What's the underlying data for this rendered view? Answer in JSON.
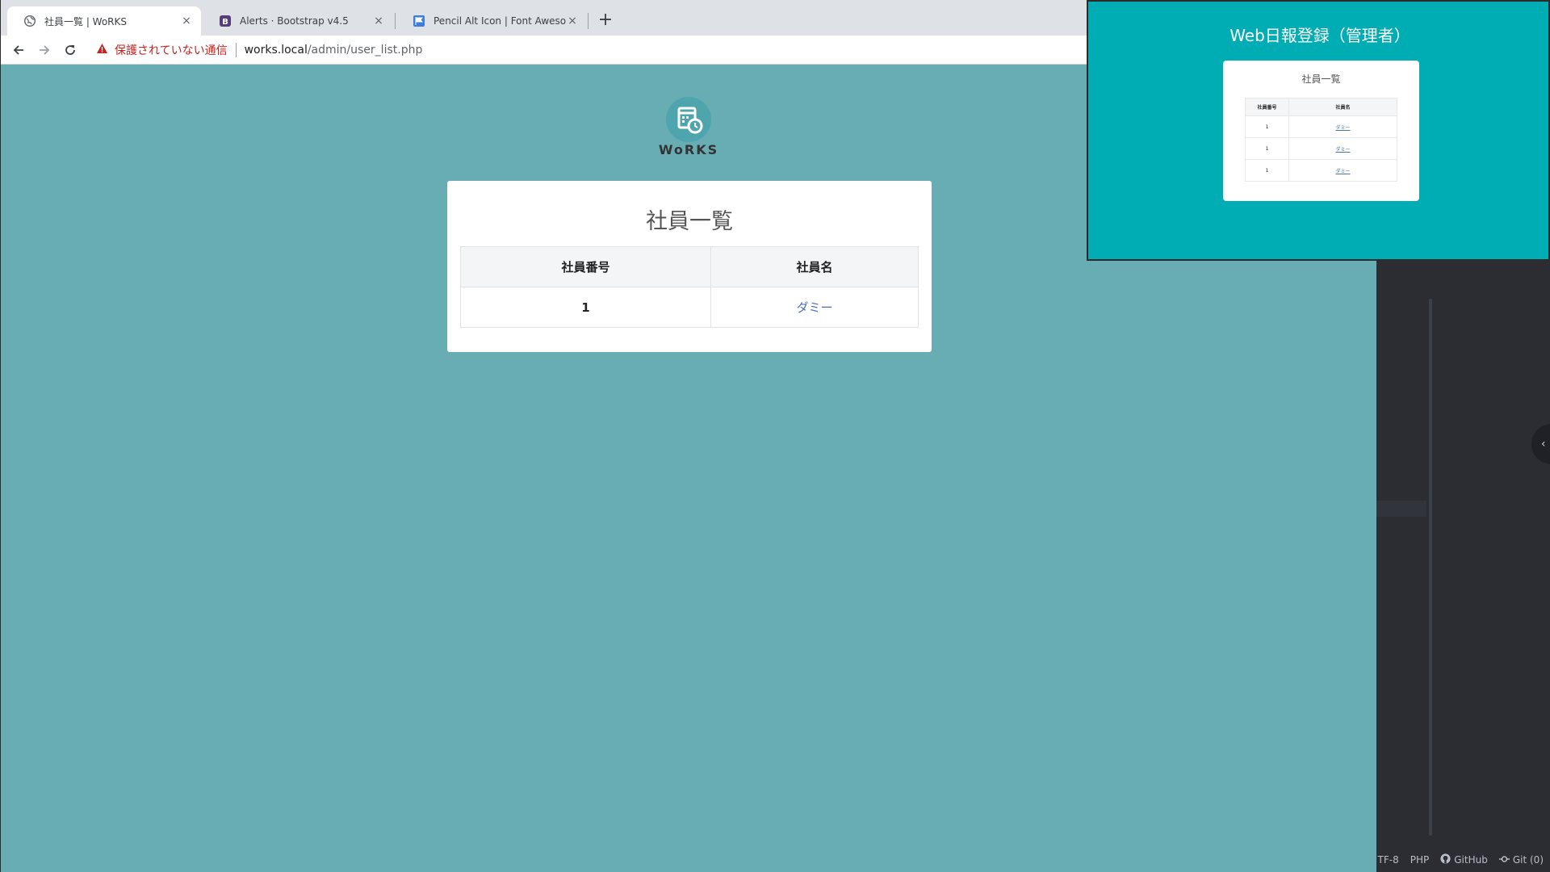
{
  "browser": {
    "tabs": [
      {
        "title": "社員一覧 | WoRKS",
        "favicon": "globe-icon",
        "active": true
      },
      {
        "title": "Alerts · Bootstrap v4.5",
        "favicon": "bootstrap-icon",
        "active": false
      },
      {
        "title": "Pencil Alt Icon | Font Awesome",
        "favicon": "flag-icon",
        "active": false
      }
    ],
    "new_tab": "+",
    "close_glyph": "×",
    "security_label": "保護されていない通信",
    "url_host": "works.local",
    "url_path": "/admin/user_list.php"
  },
  "page": {
    "logo_text": "WoRKS",
    "title": "社員一覧",
    "table": {
      "headers": [
        "社員番号",
        "社員名"
      ],
      "rows": [
        {
          "id": "1",
          "name": "ダミー"
        }
      ]
    }
  },
  "overlay": {
    "title": "Web日報登録（管理者）",
    "card_title": "社員一覧",
    "headers": [
      "社員番号",
      "社員名"
    ],
    "rows": [
      {
        "id": "1",
        "name": "ダミー"
      },
      {
        "id": "1",
        "name": "ダミー"
      },
      {
        "id": "1",
        "name": "ダミー"
      }
    ]
  },
  "ide": {
    "status": {
      "encoding": "TF-8",
      "language": "PHP",
      "github": "GitHub",
      "git": "Git (0)"
    },
    "collapse_glyph": "‹"
  },
  "colors": {
    "page_bg": "#67adb3",
    "overlay_bg": "#00adb5",
    "link": "#4a6fb5",
    "warning": "#c5221f"
  }
}
